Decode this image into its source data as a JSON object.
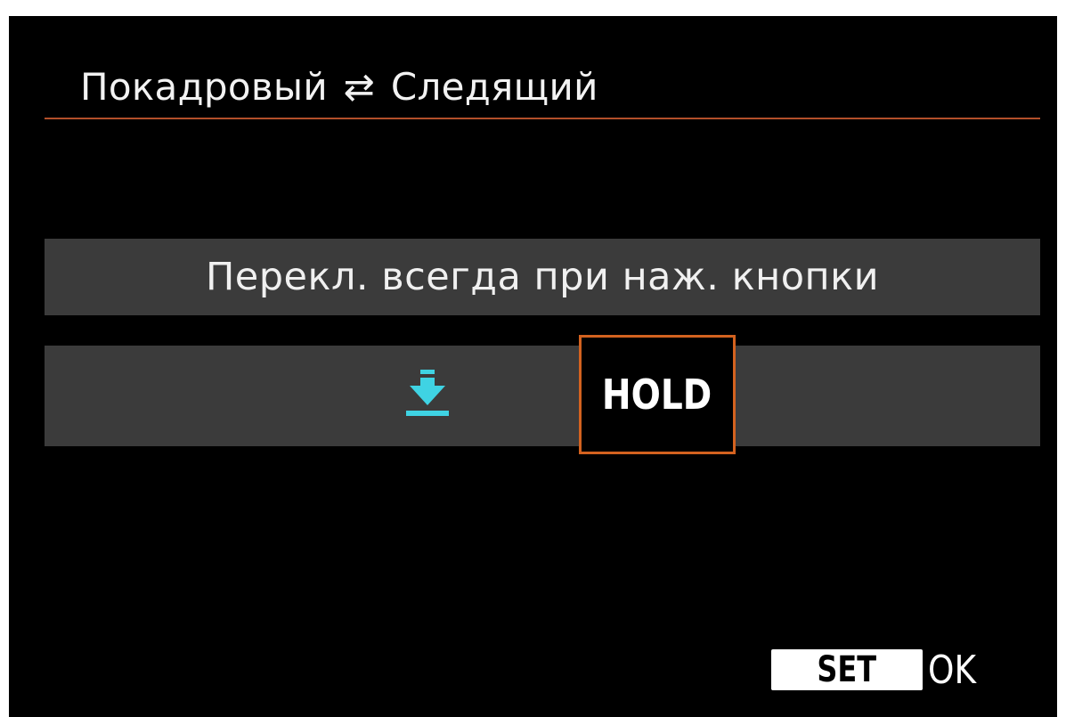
{
  "header": {
    "title_left": "Покадровый",
    "arrows": "⇄",
    "title_right": "Следящий"
  },
  "info": {
    "text": "Перекл. всегда при наж. кнопки"
  },
  "options": [
    {
      "icon": "download-arrow-icon",
      "color": "#3fd3e3",
      "selected": false
    },
    {
      "label": "HOLD",
      "selected": true
    }
  ],
  "footer": {
    "set_label": "SET",
    "ok_label": "OK"
  },
  "colors": {
    "accent": "#d3621f",
    "header_rule": "#b24f2a",
    "icon": "#3fd3e3",
    "bar": "#3b3b3b",
    "background": "#000000"
  }
}
